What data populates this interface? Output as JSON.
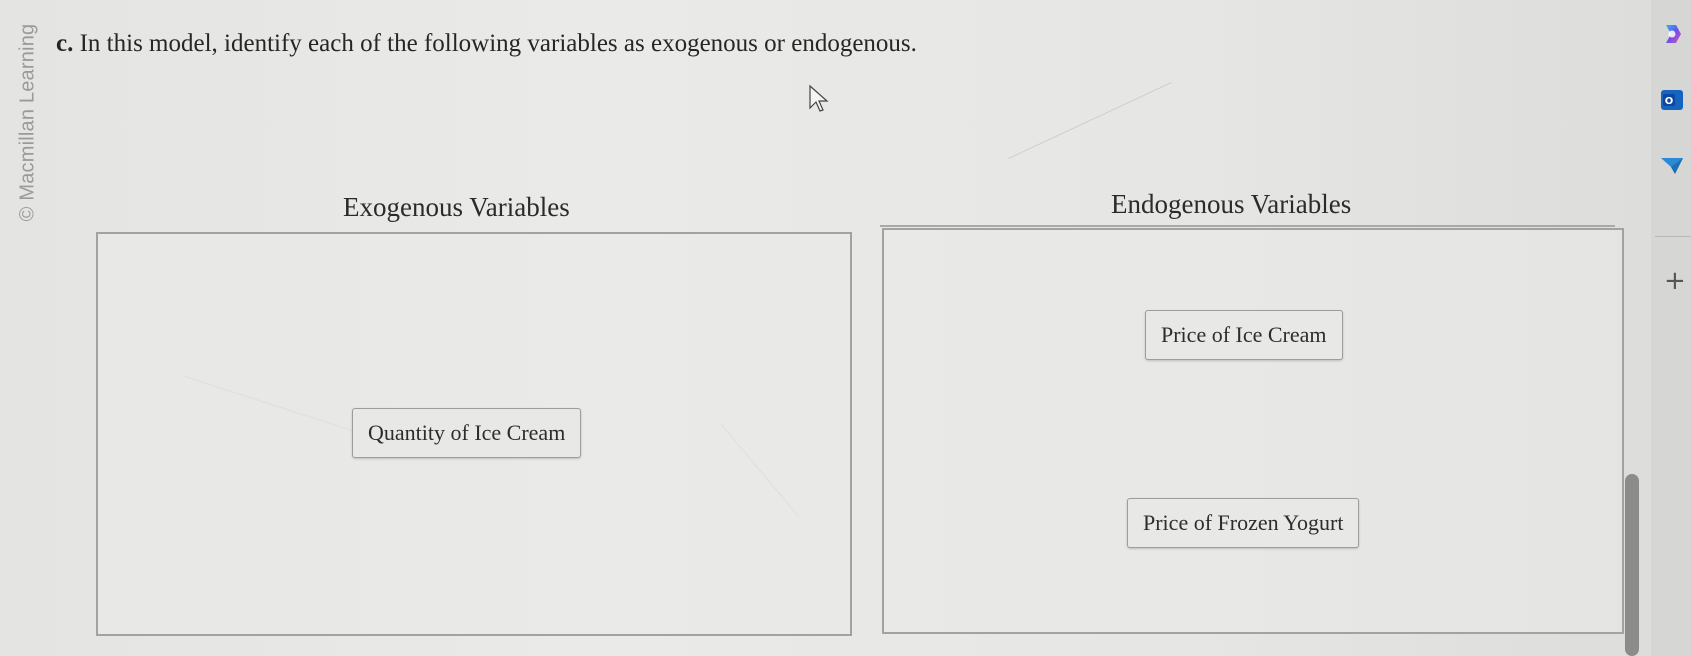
{
  "watermark": "© Macmillan Learning",
  "question": {
    "label": "c.",
    "text": "In this model, identify each of the following variables as exogenous or endogenous."
  },
  "columns": {
    "exogenous": {
      "heading": "Exogenous Variables",
      "items": [
        "Quantity of Ice Cream"
      ]
    },
    "endogenous": {
      "heading": "Endogenous Variables",
      "items": [
        "Price of Ice Cream",
        "Price of Frozen Yogurt"
      ]
    }
  },
  "sidebar": {
    "icons": [
      "copilot-icon",
      "outlook-icon",
      "send-icon"
    ],
    "add_label": "+"
  },
  "colors": {
    "page_bg": "#e6e6e4",
    "panel_border": "#a2a2a0",
    "copilot_blue": "#3b6fe6",
    "outlook_blue": "#1565c0"
  }
}
